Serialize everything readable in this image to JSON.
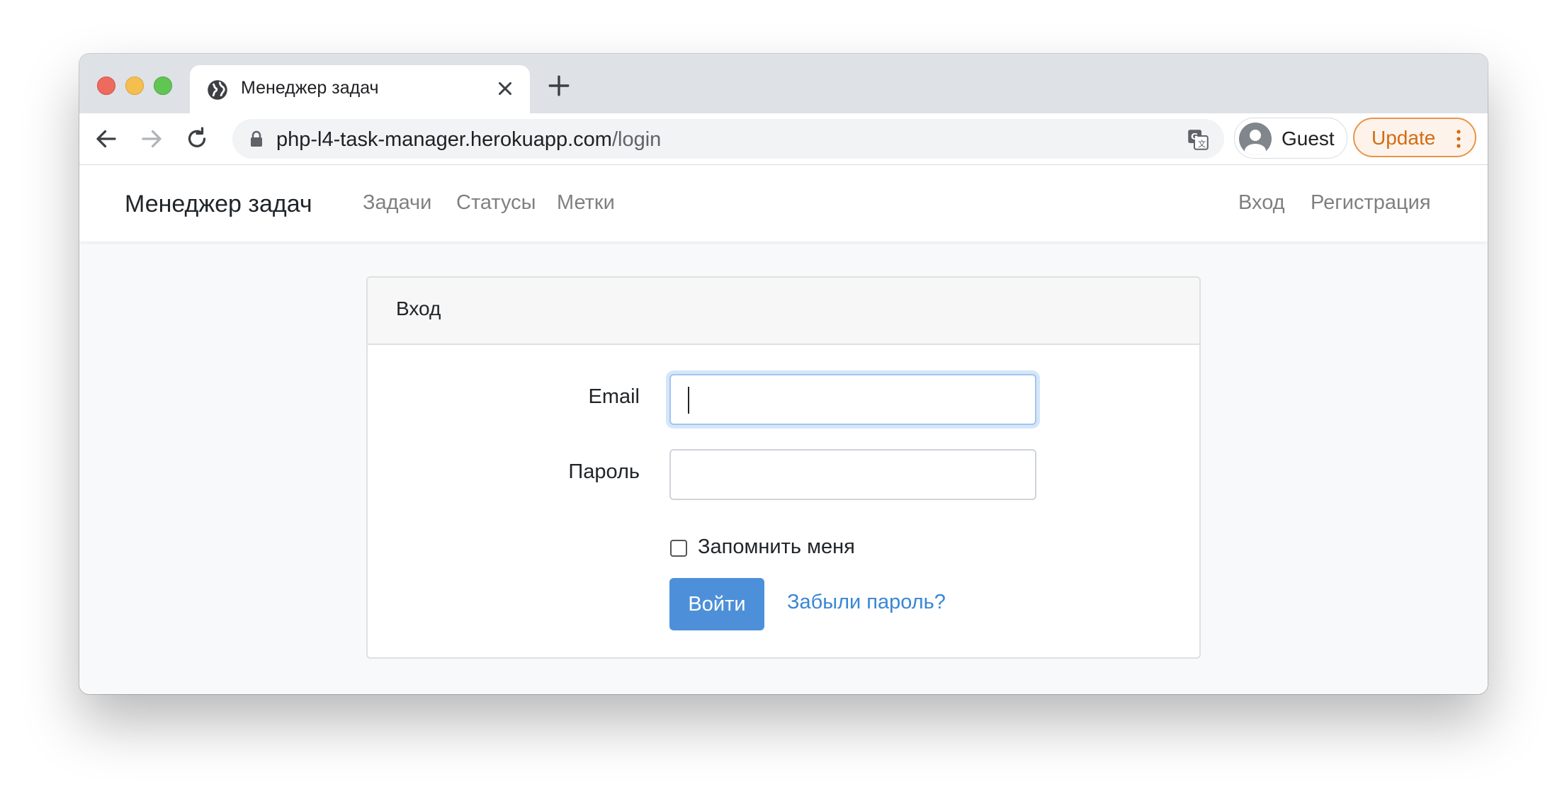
{
  "browser": {
    "tab_title": "Менеджер задач",
    "url_host": "php-l4-task-manager.herokuapp.com",
    "url_path": "/login",
    "profile_name": "Guest",
    "update_label": "Update"
  },
  "navbar": {
    "brand": "Менеджер задач",
    "links": [
      "Задачи",
      "Статусы",
      "Метки"
    ],
    "right_links": [
      "Вход",
      "Регистрация"
    ]
  },
  "login_card": {
    "title": "Вход",
    "email_label": "Email",
    "email_value": "",
    "password_label": "Пароль",
    "password_value": "",
    "remember_label": "Запомнить меня",
    "remember_checked": false,
    "submit_label": "Войти",
    "forgot_label": "Забыли пароль?"
  },
  "colors": {
    "primary": "#4d90d9",
    "link": "#3a86d4",
    "update_accent": "#d46b12"
  }
}
